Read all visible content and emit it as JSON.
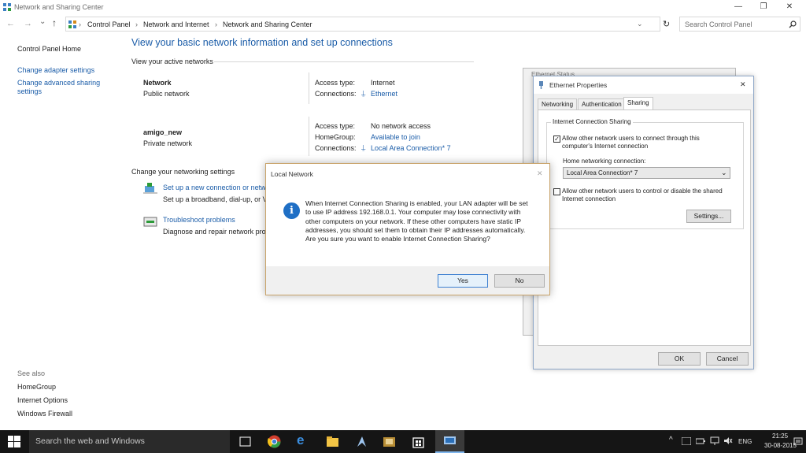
{
  "window": {
    "title": "Network and Sharing Center",
    "minimize": "—",
    "maximize": "❐",
    "close": "✕"
  },
  "nav": {
    "back": "←",
    "forward": "→",
    "down": "⌄",
    "up": "↑",
    "sep": "›",
    "breadcrumb": [
      "Control Panel",
      "Network and Internet",
      "Network and Sharing Center"
    ],
    "refresh": "↻",
    "search_placeholder": "Search Control Panel"
  },
  "sidebar": {
    "items": [
      "Control Panel Home",
      "Change adapter settings",
      "Change advanced sharing settings"
    ],
    "see_also": "See also",
    "see_also_items": [
      "HomeGroup",
      "Internet Options",
      "Windows Firewall"
    ]
  },
  "main": {
    "heading": "View your basic network information and set up connections",
    "active_networks": "View your active networks",
    "networks": [
      {
        "name": "Network",
        "type": "Public network",
        "rows": [
          {
            "label": "Access type:",
            "value": "Internet"
          },
          {
            "label": "Connections:",
            "value": "Ethernet"
          }
        ]
      },
      {
        "name": "amigo_new",
        "type": "Private network",
        "rows": [
          {
            "label": "Access type:",
            "value": "No network access"
          },
          {
            "label": "HomeGroup:",
            "value": "Available to join"
          },
          {
            "label": "Connections:",
            "value": "Local Area Connection* 7"
          }
        ]
      }
    ],
    "change_settings": "Change your networking settings",
    "tasks": [
      {
        "title": "Set up a new connection or netw",
        "desc": "Set up a broadband, dial-up, or V"
      },
      {
        "title": "Troubleshoot problems",
        "desc": "Diagnose and repair network pro"
      }
    ]
  },
  "status_window": {
    "title": "Ethernet Status"
  },
  "properties": {
    "title": "Ethernet Properties",
    "close": "✕",
    "tabs": [
      "Networking",
      "Authentication",
      "Sharing"
    ],
    "group": "Internet Connection Sharing",
    "allow_connect": "Allow other network users to connect through this computer's Internet connection",
    "home_label": "Home networking connection:",
    "home_value": "Local Area Connection* 7",
    "allow_control": "Allow other network users to control or disable the shared Internet connection",
    "settings_btn": "Settings...",
    "ok_btn": "OK",
    "cancel_btn": "Cancel"
  },
  "dialog": {
    "title": "Local Network",
    "close": "✕",
    "icon": "i",
    "message": "When Internet Connection Sharing is enabled, your LAN adapter will be set to use IP address 192.168.0.1. Your computer may lose connectivity with other computers on your network. If these other computers have static IP addresses, you should set them to obtain their IP addresses automatically.  Are you sure you want to enable Internet Connection Sharing?",
    "yes": "Yes",
    "no": "No"
  },
  "taskbar": {
    "search": "Search the web and Windows",
    "up_arrow": "^",
    "lang": "ENG",
    "time": "21:25",
    "date": "30-08-2015"
  }
}
